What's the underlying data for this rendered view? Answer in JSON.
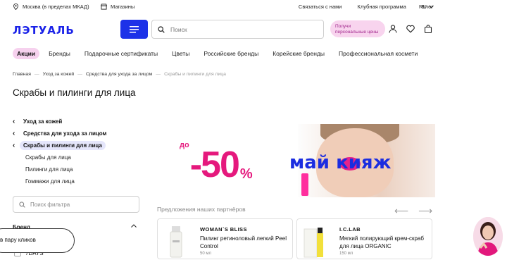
{
  "topbar": {
    "location": "Москва (в пределах МКАД)",
    "stores": "Магазины",
    "contact": "Связаться с нами",
    "club": "Клубная программа",
    "blog": "Блог",
    "lang": "RU"
  },
  "header": {
    "logo": "ЛЭТУАЛЬ",
    "search_placeholder": "Поиск",
    "promo_line1": "Получи",
    "promo_line2": "персональные цены"
  },
  "nav": {
    "items": [
      "Акции",
      "Бренды",
      "Подарочные сертификаты",
      "Цветы",
      "Российские бренды",
      "Корейские бренды",
      "Профессиональная космети"
    ]
  },
  "breadcrumbs": [
    "Главная",
    "Уход за кожей",
    "Средства для ухода за лицом",
    "Скрабы и пилинги для лица"
  ],
  "page_title": "Скрабы и пилинги для лица",
  "sidebar": {
    "parents": [
      "Уход за кожей",
      "Средства для ухода за лицом",
      "Скрабы и пилинги для лица"
    ],
    "children": [
      "Скрабы для лица",
      "Пилинги для лица",
      "Гоммажи для лица"
    ],
    "filter_placeholder": "Поиск фильтра",
    "brands_heading": "Бренд",
    "brand_item": "7DAYS",
    "quick_button": "в пару кликов"
  },
  "banner": {
    "prefix": "до",
    "discount": "-50",
    "percent": "%",
    "wordmark": "май кияж"
  },
  "offers": {
    "heading": "Предложения наших партнёров",
    "cards": [
      {
        "brand": "WOMAN`S BLISS",
        "name": "Пилинг ретиноловый легкий Peel Control",
        "volume": "50 мл"
      },
      {
        "brand": "I.C.LAB",
        "name": "Мягкий полирующий крем-скраб для лица ORGANIC",
        "volume": "150 мл"
      }
    ]
  },
  "colors": {
    "brand_blue": "#1d32e8",
    "accent_pink": "#e5197d",
    "pill_pink": "#f6d1ee"
  }
}
